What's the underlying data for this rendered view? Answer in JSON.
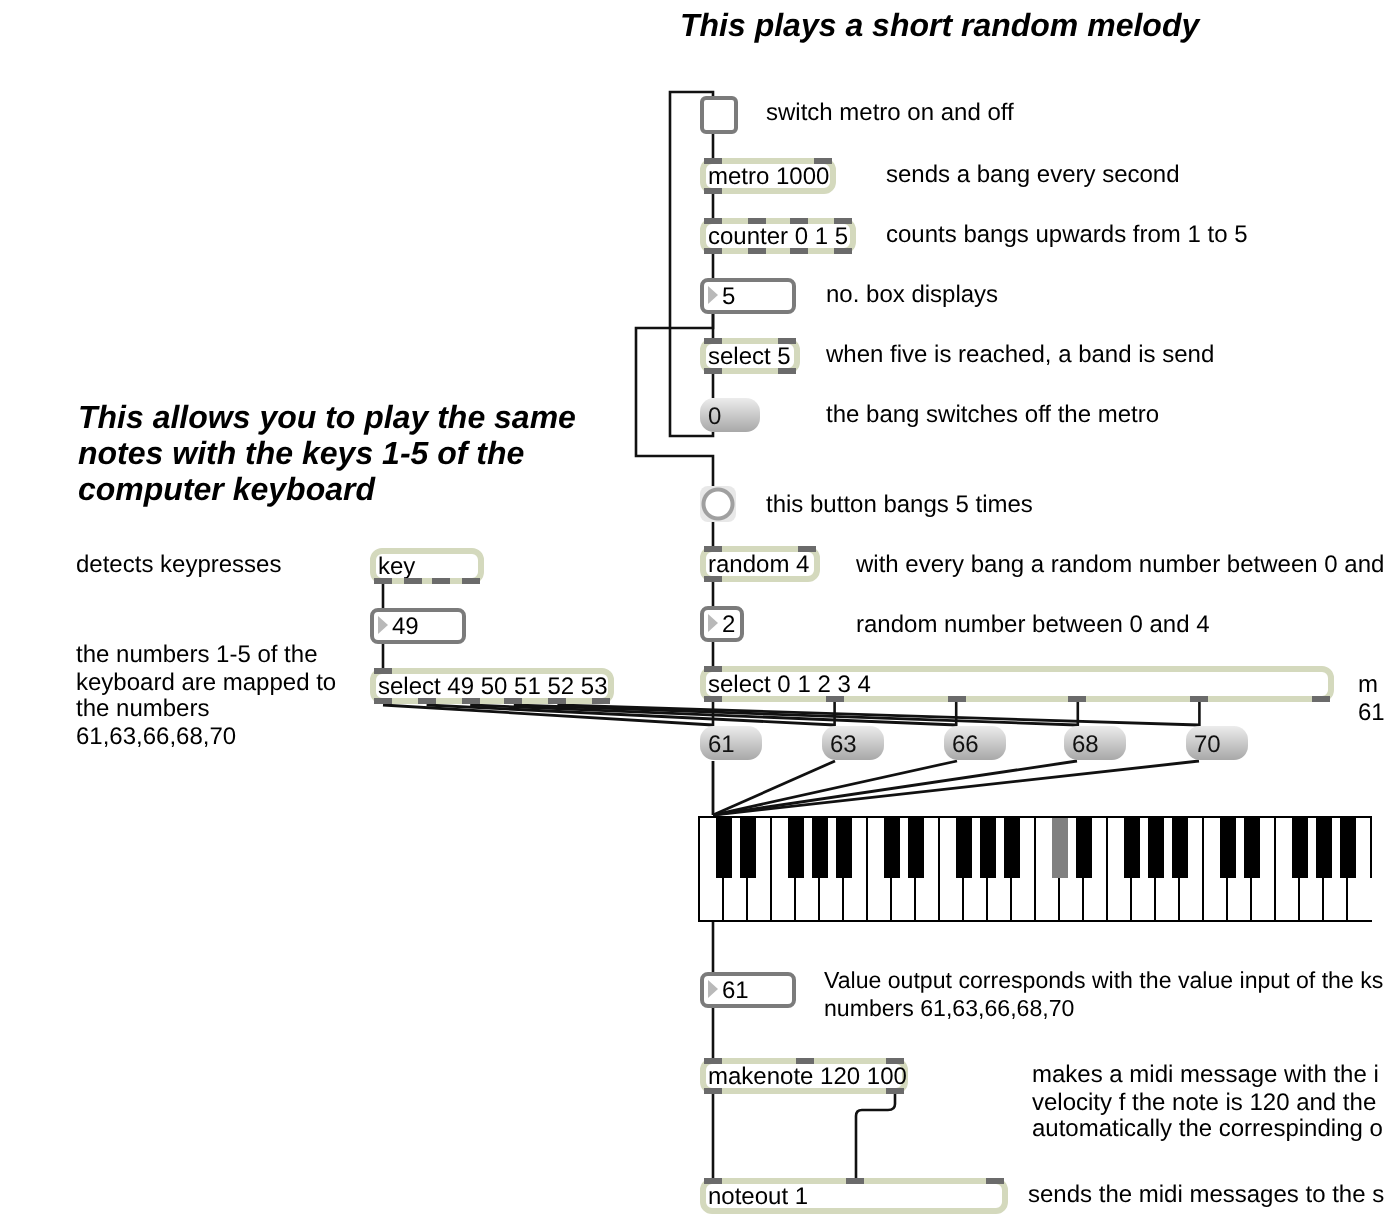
{
  "headings": [
    {
      "lines": [
        "This plays a short random melody"
      ]
    },
    {
      "lines": [
        "This allows you to play the same",
        "notes with the keys 1-5 of the",
        "computer keyboard"
      ]
    }
  ],
  "boxes": [
    {
      "kind": "toggle",
      "checked": false
    },
    {
      "kind": "object",
      "text": "metro 1000"
    },
    {
      "kind": "object",
      "text": "counter 0 1 5"
    },
    {
      "kind": "number",
      "text": "5"
    },
    {
      "kind": "object",
      "text": "select 5"
    },
    {
      "kind": "message",
      "text": "0"
    },
    {
      "kind": "bang"
    },
    {
      "kind": "object",
      "text": "random 4"
    },
    {
      "kind": "number",
      "text": "2"
    },
    {
      "kind": "object",
      "text": "select 0 1 2 3 4"
    },
    {
      "kind": "message",
      "text": "61"
    },
    {
      "kind": "message",
      "text": "63"
    },
    {
      "kind": "message",
      "text": "66"
    },
    {
      "kind": "message",
      "text": "68"
    },
    {
      "kind": "message",
      "text": "70"
    },
    {
      "kind": "number",
      "text": "61"
    },
    {
      "kind": "object",
      "text": "makenote 120 100"
    },
    {
      "kind": "object",
      "text": "noteout 1"
    },
    {
      "kind": "object",
      "text": "key"
    },
    {
      "kind": "number",
      "text": "49"
    },
    {
      "kind": "object",
      "text": "select 49 50 51 52 53"
    }
  ],
  "keyboard": {
    "keys": [
      {
        "kind": "natural",
        "selected": false
      },
      {
        "kind": "sharp",
        "selected": false
      },
      {
        "kind": "natural",
        "selected": false
      },
      {
        "kind": "sharp",
        "selected": false
      },
      {
        "kind": "natural",
        "selected": false
      },
      {
        "kind": "natural",
        "selected": false
      },
      {
        "kind": "sharp",
        "selected": false
      },
      {
        "kind": "natural",
        "selected": false
      },
      {
        "kind": "sharp",
        "selected": false
      },
      {
        "kind": "natural",
        "selected": false
      },
      {
        "kind": "sharp",
        "selected": false
      },
      {
        "kind": "natural",
        "selected": false
      },
      {
        "kind": "natural",
        "selected": false
      },
      {
        "kind": "sharp",
        "selected": false
      },
      {
        "kind": "natural",
        "selected": false
      },
      {
        "kind": "sharp",
        "selected": false
      },
      {
        "kind": "natural",
        "selected": false
      },
      {
        "kind": "natural",
        "selected": false
      },
      {
        "kind": "sharp",
        "selected": false
      },
      {
        "kind": "natural",
        "selected": false
      },
      {
        "kind": "sharp",
        "selected": false
      },
      {
        "kind": "natural",
        "selected": false
      },
      {
        "kind": "sharp",
        "selected": false
      },
      {
        "kind": "natural",
        "selected": false
      },
      {
        "kind": "natural",
        "selected": false
      },
      {
        "kind": "sharp",
        "selected": true
      },
      {
        "kind": "natural",
        "selected": false
      },
      {
        "kind": "sharp",
        "selected": false
      },
      {
        "kind": "natural",
        "selected": false
      },
      {
        "kind": "natural",
        "selected": false
      },
      {
        "kind": "sharp",
        "selected": false
      },
      {
        "kind": "natural",
        "selected": false
      },
      {
        "kind": "sharp",
        "selected": false
      },
      {
        "kind": "natural",
        "selected": false
      },
      {
        "kind": "sharp",
        "selected": false
      },
      {
        "kind": "natural",
        "selected": false
      },
      {
        "kind": "natural",
        "selected": false
      },
      {
        "kind": "sharp",
        "selected": false
      },
      {
        "kind": "natural",
        "selected": false
      },
      {
        "kind": "sharp",
        "selected": false
      },
      {
        "kind": "natural",
        "selected": false
      },
      {
        "kind": "natural",
        "selected": false
      },
      {
        "kind": "sharp",
        "selected": false
      },
      {
        "kind": "natural",
        "selected": false
      },
      {
        "kind": "sharp",
        "selected": false
      },
      {
        "kind": "natural",
        "selected": false
      },
      {
        "kind": "sharp",
        "selected": false
      },
      {
        "kind": "natural",
        "selected": false
      }
    ]
  },
  "comments": [
    {
      "lines": [
        "switch metro on and off"
      ]
    },
    {
      "lines": [
        "sends a bang every second"
      ]
    },
    {
      "lines": [
        "counts bangs upwards from 1 to 5"
      ]
    },
    {
      "lines": [
        "no. box displays"
      ]
    },
    {
      "lines": [
        "when five is reached, a band is send"
      ]
    },
    {
      "lines": [
        "the bang switches off the metro"
      ]
    },
    {
      "lines": [
        "this button bangs 5 times"
      ]
    },
    {
      "lines": [
        "with every bang a random number between 0 and"
      ]
    },
    {
      "lines": [
        "random number between 0 and 4"
      ]
    },
    {
      "lines": [
        "m",
        "61"
      ]
    },
    {
      "lines": [
        "detects keypresses"
      ]
    },
    {
      "lines": [
        "the numbers 1-5 of the",
        "keyboard are mapped to",
        "the numbers",
        "61,63,66,68,70"
      ]
    },
    {
      "lines": [
        "Value output corresponds with the value input of the ks",
        "numbers 61,63,66,68,70"
      ]
    },
    {
      "lines": [
        "makes a midi message with the i",
        "velocity f the note is 120 and the",
        "automatically the correspinding o"
      ]
    },
    {
      "lines": [
        "sends the midi messages to the s"
      ]
    }
  ]
}
